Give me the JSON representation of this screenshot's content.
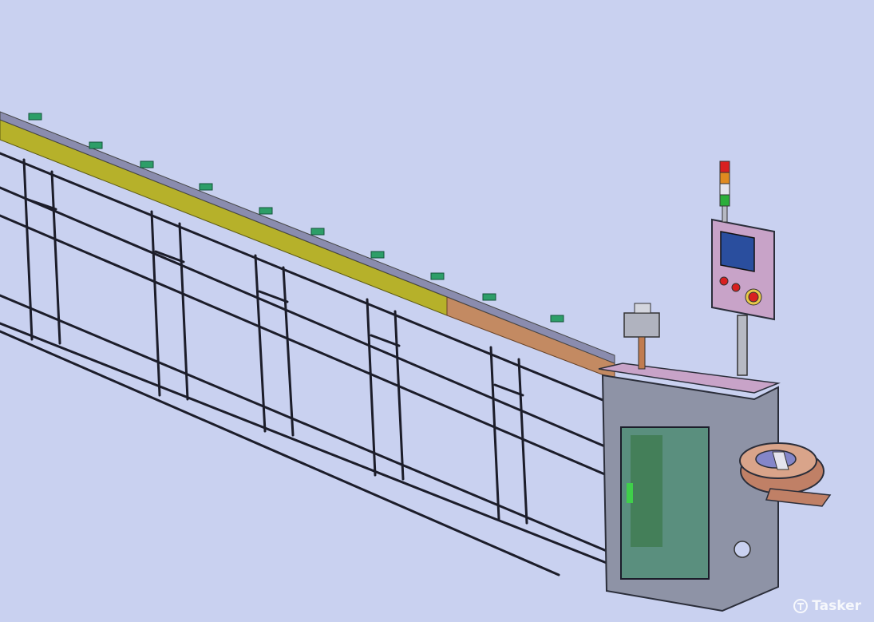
{
  "watermark": {
    "text": "Tasker",
    "icon": "tasker-logo-icon"
  },
  "colors": {
    "background": "#c9d1f0",
    "frame": "#1c1d2a",
    "tray_yellow": "#b6b12a",
    "tray_orange": "#c38a62",
    "clip_green": "#2d9e68",
    "panel_pink": "#c8a3c8",
    "screen_blue": "#2a4e9e",
    "cabinet_glass": "#5a8f7e",
    "light_red": "#d82020",
    "light_orange": "#e08a20",
    "light_green": "#2cae3a"
  }
}
